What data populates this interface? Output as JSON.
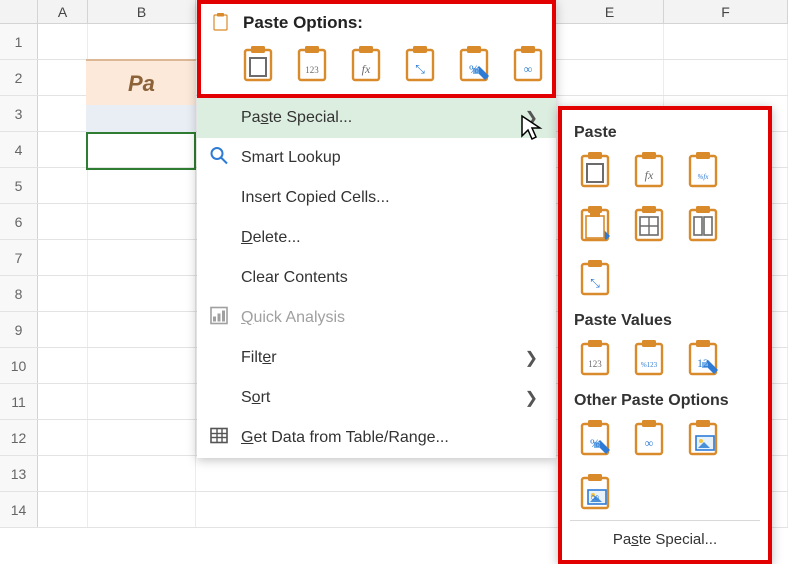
{
  "columns": {
    "A": "A",
    "B": "B",
    "E": "E",
    "F": "F"
  },
  "row_headers": [
    "1",
    "2",
    "3",
    "4",
    "5",
    "6",
    "7",
    "8",
    "9",
    "10",
    "11",
    "12",
    "13",
    "14"
  ],
  "partial_cell_text": "Pa",
  "context_menu": {
    "title": "Paste Options:",
    "paste_options_icons": [
      "paste-all",
      "paste-values",
      "paste-formulas",
      "paste-transpose",
      "paste-formatting",
      "paste-link"
    ],
    "items": [
      {
        "key": "paste_special",
        "label": "Paste Special...",
        "accel": "S",
        "has_submenu": true,
        "hovered": true,
        "icon": null,
        "disabled": false
      },
      {
        "key": "smart_lookup",
        "label": "Smart Lookup",
        "accel": null,
        "has_submenu": false,
        "icon": "search-icon",
        "disabled": false
      },
      {
        "key": "insert_copied",
        "label": "Insert Copied Cells...",
        "accel": null,
        "has_submenu": false,
        "icon": null,
        "disabled": false
      },
      {
        "key": "delete",
        "label": "Delete...",
        "accel": "D",
        "has_submenu": false,
        "icon": null,
        "disabled": false
      },
      {
        "key": "clear_contents",
        "label": "Clear Contents",
        "accel": null,
        "has_submenu": false,
        "icon": null,
        "disabled": false
      },
      {
        "key": "quick_analysis",
        "label": "Quick Analysis",
        "accel": "Q",
        "has_submenu": false,
        "icon": "quick-analysis-icon",
        "disabled": true
      },
      {
        "key": "filter",
        "label": "Filter",
        "accel": "e",
        "has_submenu": true,
        "icon": null,
        "disabled": false
      },
      {
        "key": "sort",
        "label": "Sort",
        "accel": "o",
        "has_submenu": true,
        "icon": null,
        "disabled": false
      },
      {
        "key": "get_data",
        "label": "Get Data from Table/Range...",
        "accel": "G",
        "has_submenu": false,
        "icon": "table-icon",
        "disabled": false
      }
    ]
  },
  "flyout": {
    "sections": [
      {
        "title": "Paste",
        "icons": [
          "paste-all",
          "paste-formulas",
          "paste-formulas-number-fmt",
          "paste-keep-source-fmt",
          "paste-no-borders",
          "paste-column-widths",
          "paste-transpose"
        ]
      },
      {
        "title": "Paste Values",
        "icons": [
          "paste-values",
          "paste-values-number-fmt",
          "paste-values-source-fmt"
        ]
      },
      {
        "title": "Other Paste Options",
        "icons": [
          "paste-formatting",
          "paste-link",
          "paste-picture",
          "paste-linked-picture"
        ]
      }
    ],
    "special_label": "Paste Special...",
    "special_accel": "S"
  }
}
